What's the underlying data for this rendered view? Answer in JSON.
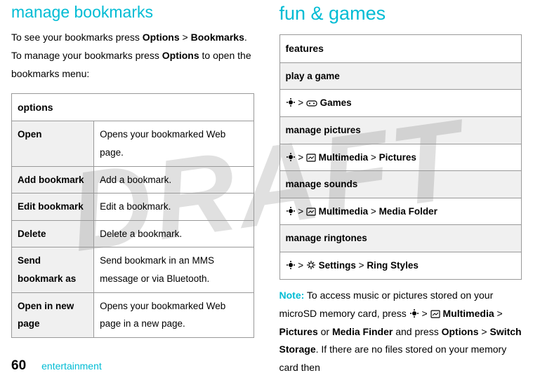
{
  "left": {
    "title": "manage bookmarks",
    "intro_parts": {
      "p1": "To see your bookmarks press ",
      "opt1": "Options",
      "gt1": " > ",
      "bkm": "Bookmarks",
      "p2": ". To manage your bookmarks press ",
      "opt2": "Options",
      "p3": " to open the bookmarks menu:"
    },
    "table_header": "options",
    "rows": [
      {
        "opt": "Open",
        "desc": "Opens your bookmarked Web page."
      },
      {
        "opt": "Add bookmark",
        "desc": "Add a bookmark."
      },
      {
        "opt": "Edit bookmark",
        "desc": "Edit a bookmark."
      },
      {
        "opt": "Delete",
        "desc": "Delete a bookmark."
      },
      {
        "opt": "Send bookmark as",
        "desc": "Send bookmark in an MMS message or via Bluetooth."
      },
      {
        "opt": "Open in new page",
        "desc": "Opens your bookmarked Web page in a new page."
      }
    ]
  },
  "right": {
    "title": "fun & games",
    "table_header": "features",
    "rows": [
      {
        "sub": "play a game",
        "path_label": "Games",
        "icon2": "games"
      },
      {
        "sub": "manage pictures",
        "path_label": "Multimedia",
        "path_tail": "Pictures",
        "icon2": "multimedia"
      },
      {
        "sub": "manage sounds",
        "path_label": "Multimedia",
        "path_tail": "Media Folder",
        "icon2": "multimedia"
      },
      {
        "sub": "manage ringtones",
        "path_label": "Settings",
        "path_tail": "Ring Styles",
        "icon2": "settings"
      }
    ],
    "note": {
      "label": "Note:",
      "t1": " To access music or pictures stored on your microSD memory card, press ",
      "gt": " > ",
      "mm": "Multimedia",
      "gt2": " > ",
      "pic": "Pictures",
      "or": " or ",
      "mf": "Media Finder",
      "and": " and press ",
      "opt": "Options",
      "gt3": " > ",
      "ss": "Switch Storage",
      "t2": ". If there are no files stored on your memory card then"
    }
  },
  "footer": {
    "page": "60",
    "section": "entertainment"
  },
  "watermark": "DRAFT"
}
